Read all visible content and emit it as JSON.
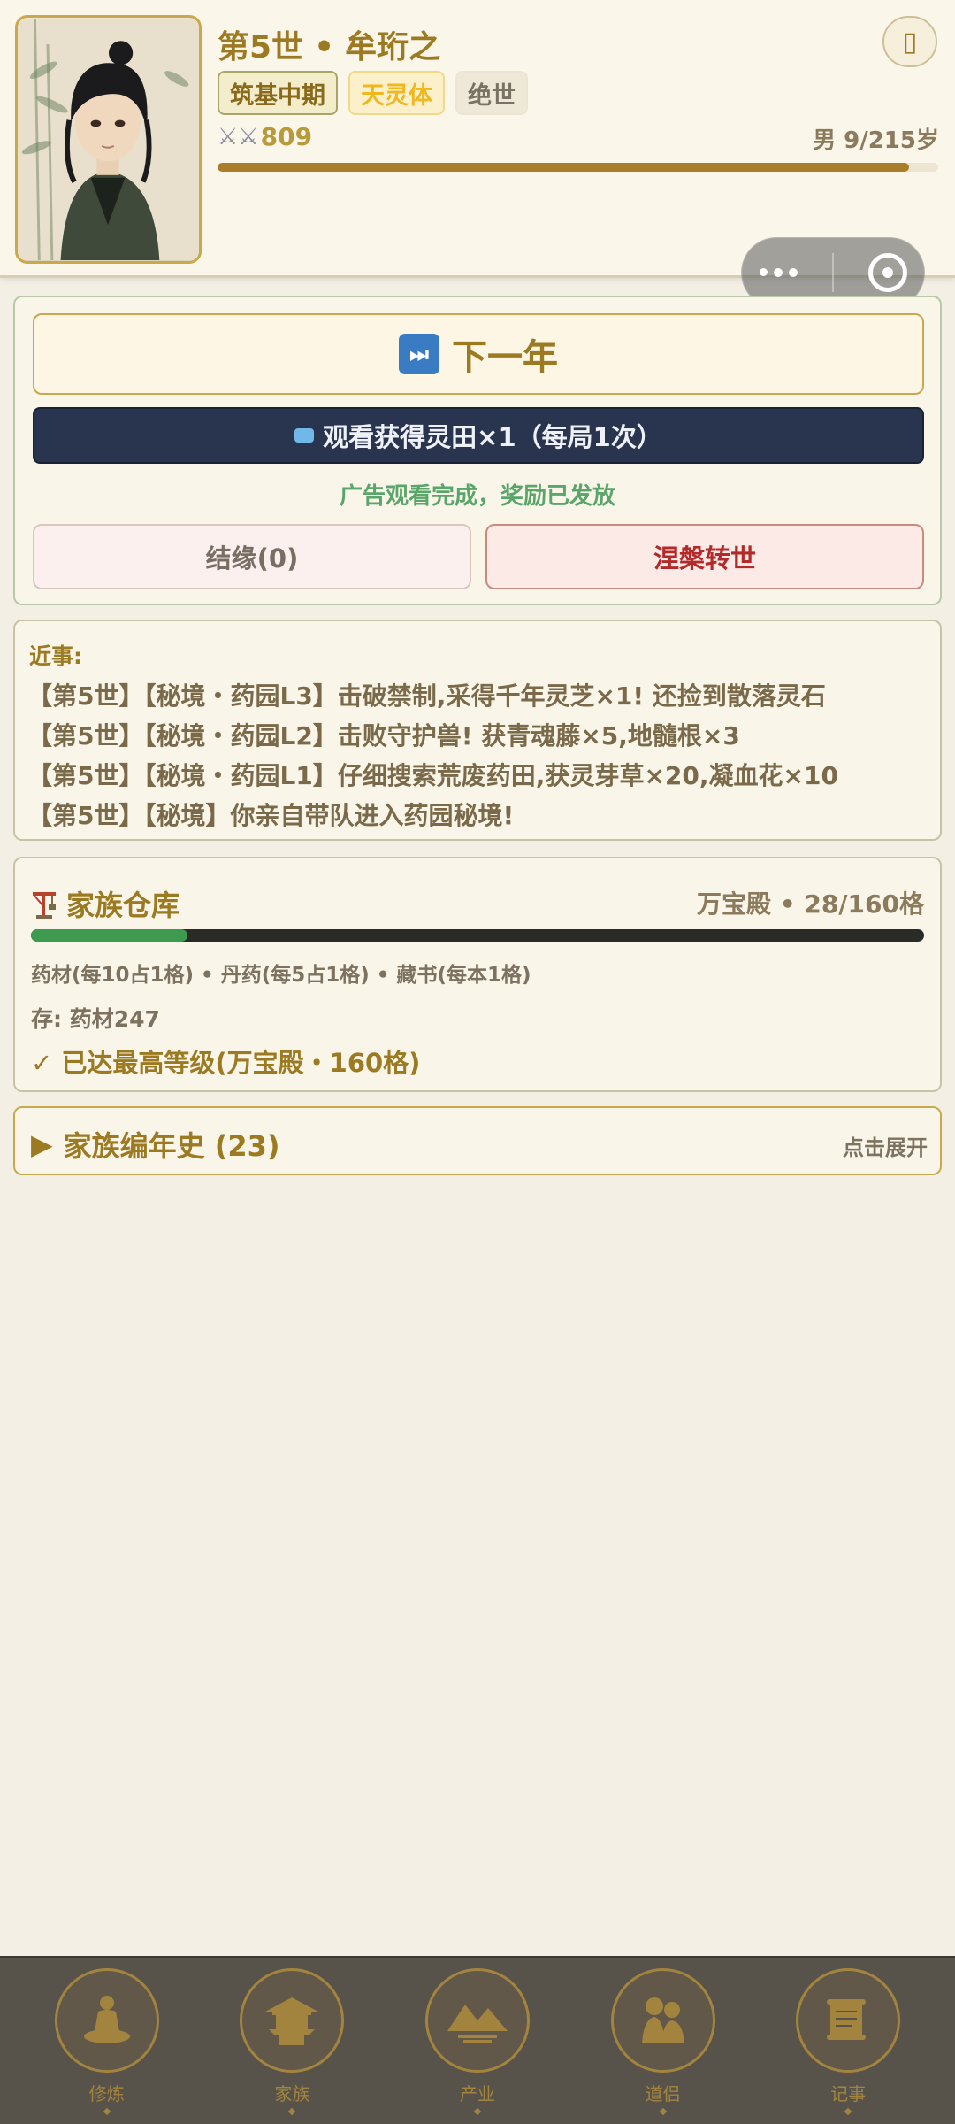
{
  "header": {
    "generation": "第5世",
    "separator": "•",
    "name": "牟珩之",
    "menu_icon": "menu-icon",
    "tags": {
      "realm": "筑基中期",
      "body": "天灵体",
      "talent": "绝世"
    },
    "power_icons": "⚔⚔",
    "power": "809",
    "age_text": "男 9/215岁",
    "lifespan_used": 9,
    "lifespan_total": 215,
    "progress_color": "#a97d2a"
  },
  "actions": {
    "next_year_label": "下一年",
    "ad_button_label": "观看获得灵田×1（每局1次）",
    "ad_message": "广告观看完成，奖励已发放",
    "marry_label": "结缘(0)",
    "rebirth_label": "涅槃转世"
  },
  "news": {
    "title": "近事:",
    "items": [
      "【第5世】【秘境・药园L3】击破禁制,采得千年灵芝×1! 还捡到散落灵石",
      "【第5世】【秘境・药园L2】击败守护兽! 获青魂藤×5,地髓根×3",
      "【第5世】【秘境・药园L1】仔细搜索荒废药田,获灵芽草×20,凝血花×10",
      "【第5世】【秘境】你亲自带队进入药园秘境!"
    ]
  },
  "storage": {
    "title": "家族仓库",
    "meta": "万宝殿 • 28/160格",
    "used": 28,
    "capacity": 160,
    "rules": "药材(每10占1格) • 丹药(每5占1格) • 藏书(每本1格)",
    "stock": "存: 药材247",
    "max_level": "✓ 已达最高等级(万宝殿・160格)",
    "bar_color": "#3d9a4e"
  },
  "chronicle": {
    "arrow": "▶",
    "title": "家族编年史 (23)",
    "hint": "点击展开"
  },
  "tabbar": {
    "items": [
      {
        "label": "修炼",
        "icon": "meditation-icon"
      },
      {
        "label": "家族",
        "icon": "pavilion-icon"
      },
      {
        "label": "产业",
        "icon": "landscape-icon"
      },
      {
        "label": "道侣",
        "icon": "couple-icon"
      },
      {
        "label": "记事",
        "icon": "scroll-icon"
      }
    ]
  }
}
